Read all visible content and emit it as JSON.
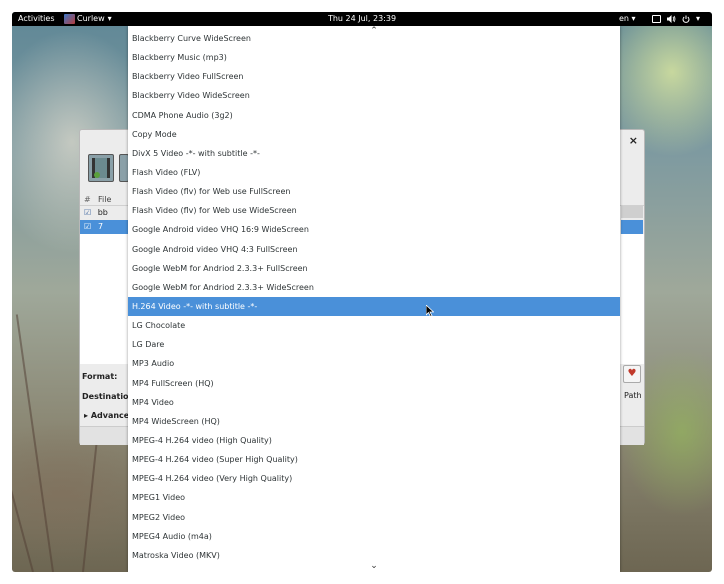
{
  "topbar": {
    "activities": "Activities",
    "app_name": "Curlew",
    "app_arrow": "▾",
    "clock": "Thu 24 Jul, 23:39",
    "language": "en",
    "lang_arrow": "▾",
    "volume_icon": "speaker-icon",
    "power_icon": "power-icon"
  },
  "dialog": {
    "close": "×",
    "file_header_hash": "#",
    "file_header_name": "File",
    "files": [
      {
        "name": "bb",
        "checked": true,
        "selected": false
      },
      {
        "name": "7",
        "checked": true,
        "selected": true
      }
    ],
    "format_label": "Format:",
    "destination_label": "Destination:",
    "advanced_label": "Advanced",
    "advanced_arrow": "▸",
    "path_label": "Path",
    "favorite_icon": "♥"
  },
  "dropdown": {
    "scroll_up": "⌃",
    "scroll_down": "⌄",
    "items": [
      "Blackberry Curve WideScreen",
      "Blackberry Music (mp3)",
      "Blackberry Video FullScreen",
      "Blackberry Video WideScreen",
      "CDMA Phone Audio (3g2)",
      "Copy Mode",
      "DivX 5 Video -*- with subtitle -*-",
      "Flash Video (FLV)",
      "Flash Video (flv) for Web use FullScreen",
      "Flash Video (flv) for Web use WideScreen",
      "Google Android video VHQ 16:9 WideScreen",
      "Google Android video VHQ 4:3 FullScreen",
      "Google WebM for Andriod 2.3.3+ FullScreen",
      "Google WebM for Andriod 2.3.3+ WideScreen",
      "H.264 Video -*- with subtitle -*-",
      "LG Chocolate",
      "LG Dare",
      "MP3 Audio",
      "MP4 FullScreen (HQ)",
      "MP4 Video",
      "MP4 WideScreen (HQ)",
      "MPEG-4 H.264 video (High Quality)",
      "MPEG-4 H.264 video (Super High Quality)",
      "MPEG-4 H.264 video (Very High Quality)",
      "MPEG1 Video",
      "MPEG2 Video",
      "MPEG4 Audio (m4a)",
      "Matroska Video (MKV)"
    ],
    "selected_index": 14
  },
  "colors": {
    "selection": "#4a90d9",
    "topbar": "#000000"
  }
}
